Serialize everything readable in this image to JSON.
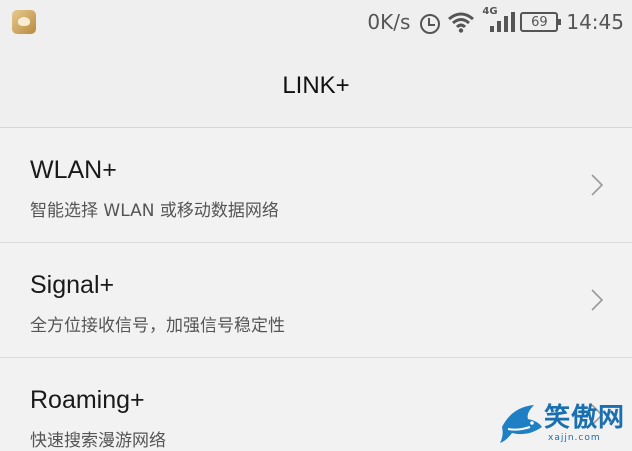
{
  "status_bar": {
    "net_speed": "0K/s",
    "network_type": "4G",
    "battery": "69",
    "time": "14:45",
    "icons": [
      "app-icon",
      "alarm-icon",
      "wifi-icon",
      "signal-icon",
      "battery-icon"
    ]
  },
  "header": {
    "title": "LINK+"
  },
  "items": [
    {
      "title": "WLAN+",
      "subtitle": "智能选择 WLAN 或移动数据网络"
    },
    {
      "title": "Signal+",
      "subtitle": "全方位接收信号，加强信号稳定性"
    },
    {
      "title": "Roaming+",
      "subtitle": "快速搜索漫游网络"
    }
  ],
  "watermark": {
    "text": "笑傲网",
    "url": "xajjn.com"
  }
}
